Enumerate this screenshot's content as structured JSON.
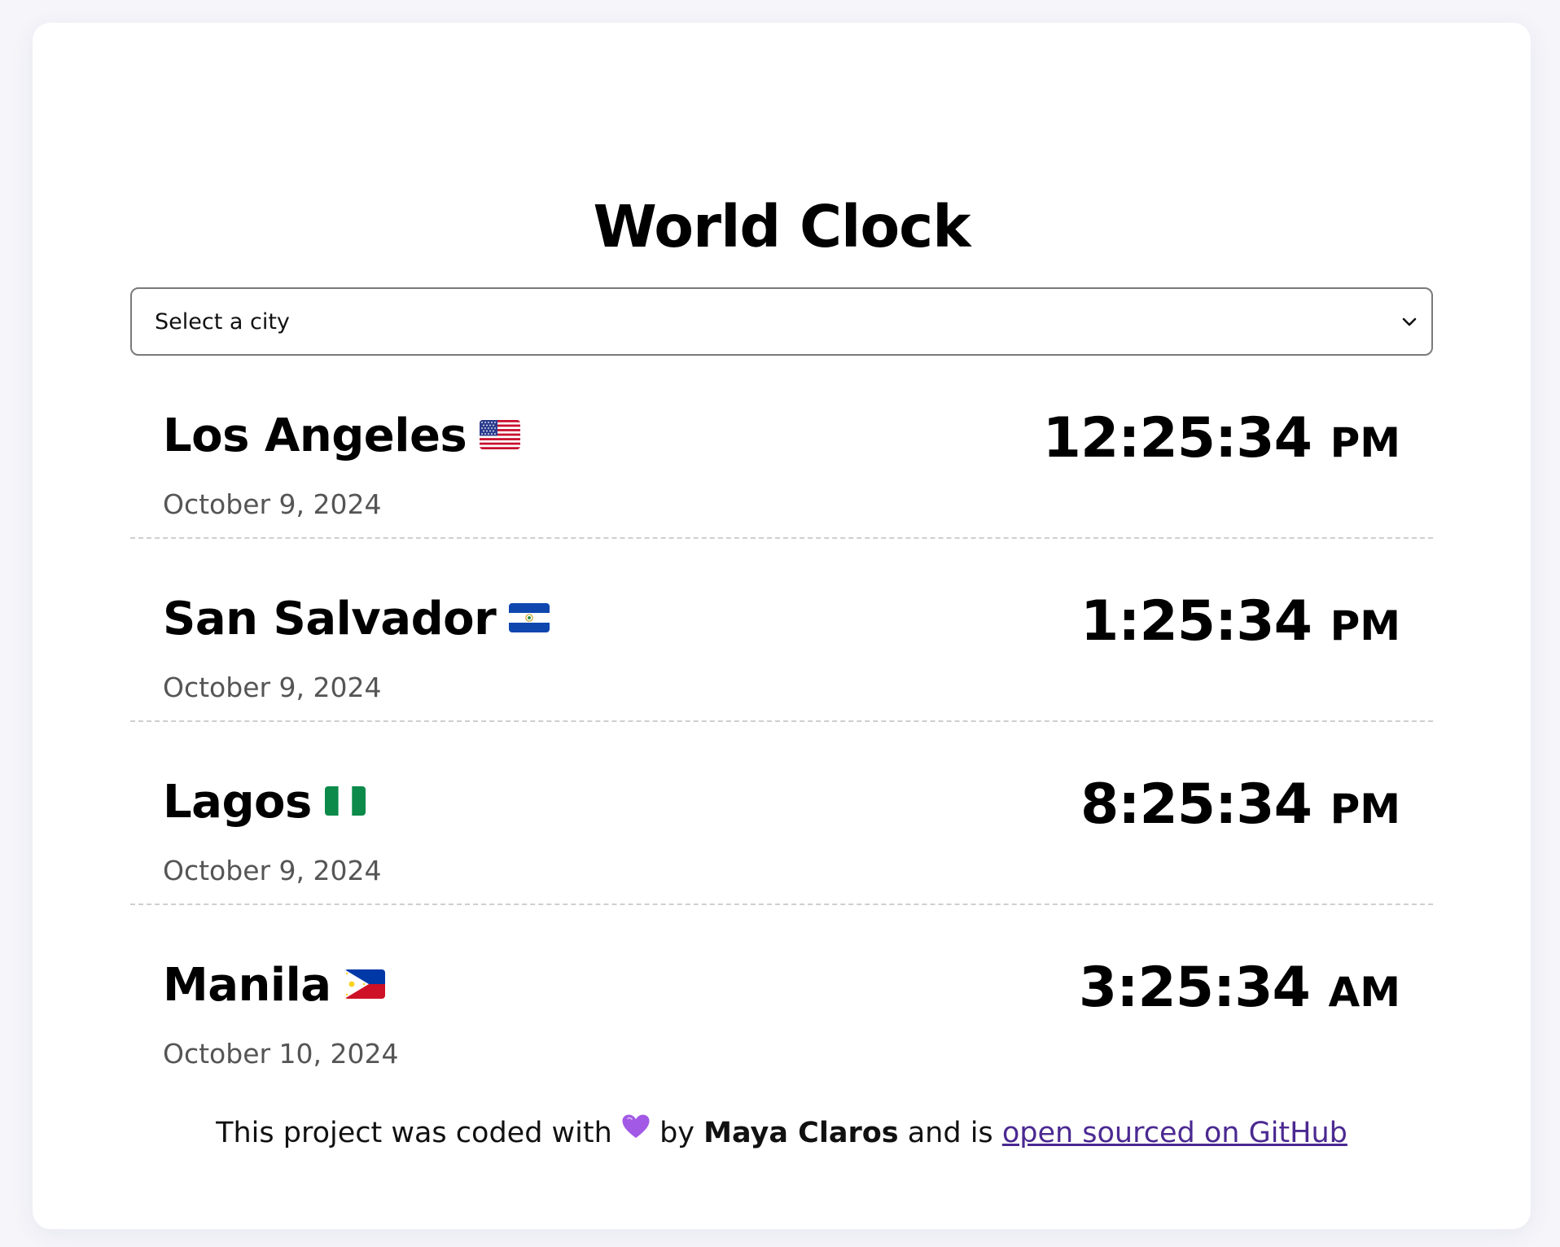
{
  "app": {
    "title": "World Clock"
  },
  "city_select": {
    "placeholder": "Select a city",
    "icon": "chevron-down-icon"
  },
  "cities": [
    {
      "name": "Los Angeles",
      "flag": "us-flag-icon",
      "date": "October 9, 2024",
      "time": "12:25:34",
      "ampm": "PM"
    },
    {
      "name": "San Salvador",
      "flag": "el-salvador-flag-icon",
      "date": "October 9, 2024",
      "time": "1:25:34",
      "ampm": "PM"
    },
    {
      "name": "Lagos",
      "flag": "nigeria-flag-icon",
      "date": "October 9, 2024",
      "time": "8:25:34",
      "ampm": "PM"
    },
    {
      "name": "Manila",
      "flag": "philippines-flag-icon",
      "date": "October 10, 2024",
      "time": "3:25:34",
      "ampm": "AM"
    }
  ],
  "footer": {
    "prefix": "This project was coded with",
    "by": "by",
    "author": "Maya Claros",
    "middle": "and is",
    "link_text": "open sourced on GitHub",
    "heart_color": "#a259e6"
  },
  "colors": {
    "link": "#4b2991",
    "date_text": "#555555"
  }
}
